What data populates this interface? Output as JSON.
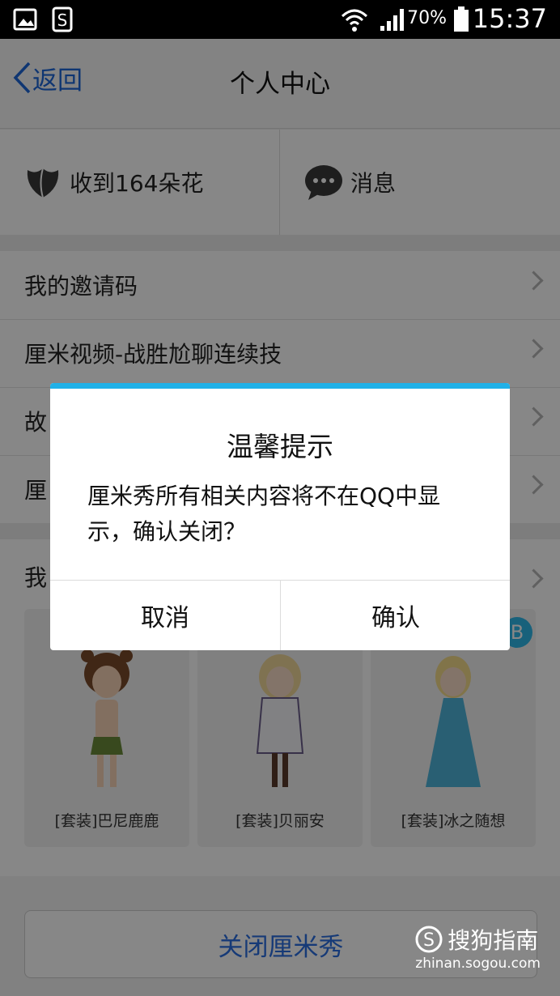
{
  "status_bar": {
    "battery": "70%",
    "time": "15:37"
  },
  "nav": {
    "back_label": "返回",
    "title": "个人中心"
  },
  "quick": {
    "flowers_label": "收到164朵花",
    "messages_label": "消息"
  },
  "list": [
    {
      "label": "我的邀请码"
    },
    {
      "label": "厘米视频-战胜尬聊连续技"
    },
    {
      "label": "故"
    },
    {
      "label": "厘"
    }
  ],
  "outfits": {
    "section_label": "我",
    "items": [
      {
        "name": "[套装]巴尼鹿鹿"
      },
      {
        "name": "[套装]贝丽安"
      },
      {
        "name": "[套装]冰之随想"
      }
    ],
    "badge_letter": "B"
  },
  "close_button": "关闭厘米秀",
  "dialog": {
    "title": "温馨提示",
    "message": "厘米秀所有相关内容将不在QQ中显示，确认关闭？",
    "cancel": "取消",
    "confirm": "确认"
  },
  "watermark": {
    "brand": "搜狗指南",
    "url": "zhinan.sogou.com"
  },
  "colors": {
    "accent": "#1e66d8",
    "dialog_top": "#20b1e8"
  }
}
